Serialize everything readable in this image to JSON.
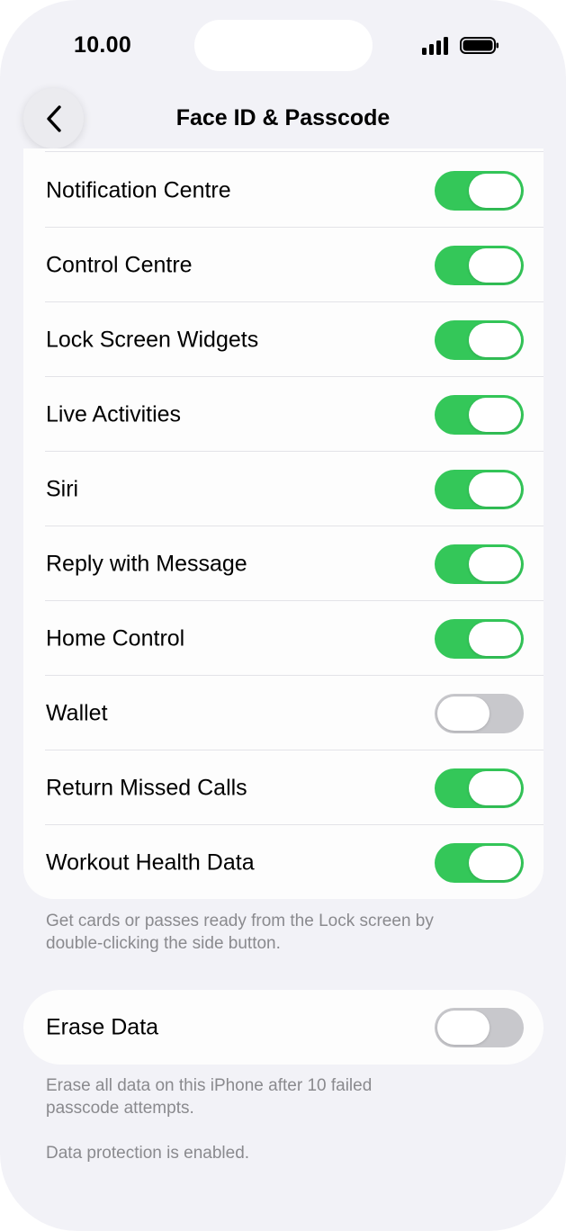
{
  "status_bar": {
    "time": "10.00"
  },
  "nav": {
    "back_icon": "chevron-left-icon",
    "title": "Face ID & Passcode"
  },
  "lock_screen_access": {
    "items": [
      {
        "label": "Notification Centre",
        "on": true
      },
      {
        "label": "Control Centre",
        "on": true
      },
      {
        "label": "Lock Screen Widgets",
        "on": true
      },
      {
        "label": "Live Activities",
        "on": true
      },
      {
        "label": "Siri",
        "on": true
      },
      {
        "label": "Reply with Message",
        "on": true
      },
      {
        "label": "Home Control",
        "on": true
      },
      {
        "label": "Wallet",
        "on": false
      },
      {
        "label": "Return Missed Calls",
        "on": true
      },
      {
        "label": "Workout Health Data",
        "on": true
      }
    ],
    "footer_line1": "Get cards or passes ready from the Lock screen by",
    "footer_line2": "double-clicking the side button."
  },
  "erase": {
    "label": "Erase Data",
    "on": false,
    "footer_line1": "Erase all data on this iPhone after 10 failed",
    "footer_line2": "passcode attempts.",
    "footer_line3": "Data protection is enabled."
  },
  "colors": {
    "toggle_on": "#34c759",
    "toggle_off": "#c8c8cc",
    "background": "#f2f2f7"
  }
}
